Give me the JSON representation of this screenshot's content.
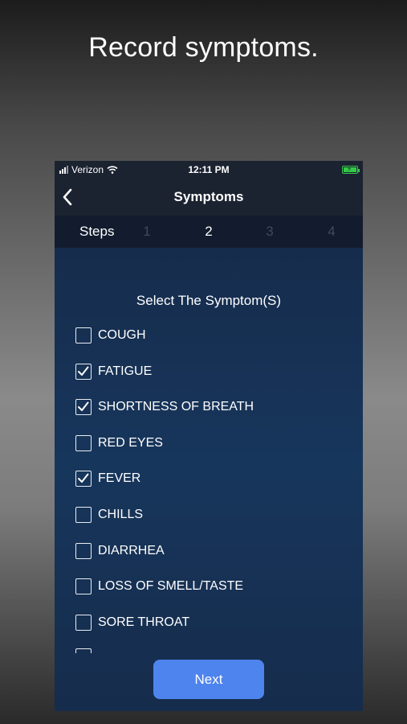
{
  "marketing": {
    "title": "Record symptoms."
  },
  "status_bar": {
    "carrier": "Verizon",
    "time": "12:11 PM"
  },
  "nav": {
    "title": "Symptoms",
    "back_icon": "chevron-left-icon"
  },
  "steps": {
    "label": "Steps",
    "items": [
      "1",
      "2",
      "3",
      "4"
    ],
    "current": "2"
  },
  "form": {
    "heading": "Select The Symptom(S)",
    "symptoms": [
      {
        "label": "COUGH",
        "checked": false
      },
      {
        "label": "FATIGUE",
        "checked": true
      },
      {
        "label": "SHORTNESS OF BREATH",
        "checked": true
      },
      {
        "label": "RED EYES",
        "checked": false
      },
      {
        "label": "FEVER",
        "checked": true
      },
      {
        "label": "CHILLS",
        "checked": false
      },
      {
        "label": "DIARRHEA",
        "checked": false
      },
      {
        "label": "LOSS OF SMELL/TASTE",
        "checked": false
      },
      {
        "label": "SORE THROAT",
        "checked": false
      }
    ],
    "next_label": "Next"
  },
  "colors": {
    "accent": "#4e84ee",
    "battery": "#35c94a",
    "nav_bg": "#1b2230"
  }
}
